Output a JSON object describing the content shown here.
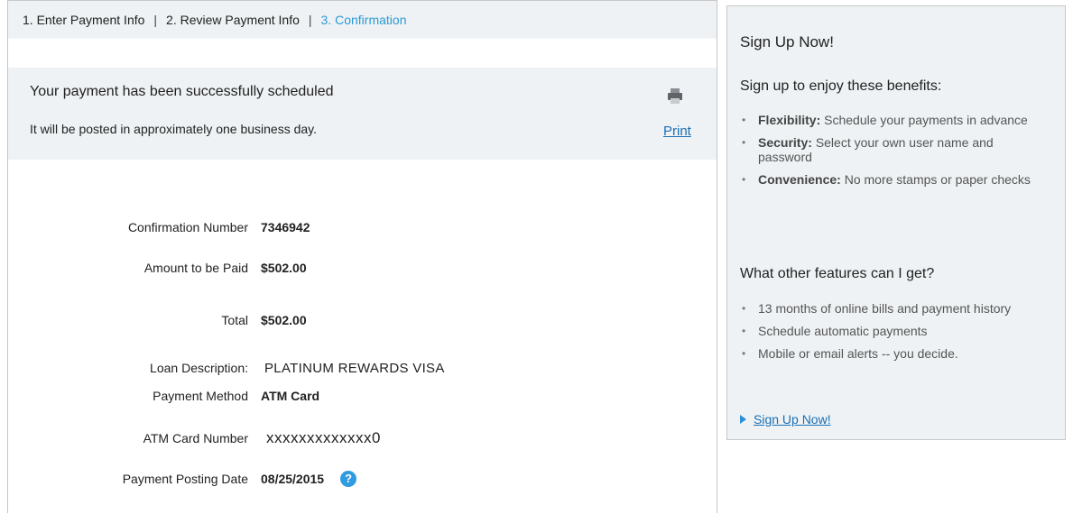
{
  "steps": {
    "step1": "1. Enter Payment Info",
    "step2": "2. Review Payment Info",
    "step3": "3. Confirmation",
    "separator": "|"
  },
  "notice": {
    "headline": "Your payment has been successfully scheduled",
    "sub": "It will be posted in approximately one business day.",
    "print_label": "Print"
  },
  "details": {
    "confirmation_label": "Confirmation Number",
    "confirmation_value": "7346942",
    "amount_label": "Amount to be Paid",
    "amount_value": "$502.00",
    "total_label": "Total",
    "total_value": "$502.00",
    "loan_label": "Loan Description:",
    "loan_value": "PLATINUM REWARDS VISA",
    "method_label": "Payment Method",
    "method_value": "ATM Card",
    "card_label": "ATM Card Number",
    "card_value": "xxxxxxxxxxxxx0",
    "date_label": "Payment Posting Date",
    "date_value": "08/25/2015",
    "help_glyph": "?"
  },
  "sidebar": {
    "title": "Sign Up Now!",
    "benefits_heading": "Sign up to enjoy these benefits:",
    "benefits": [
      {
        "term": "Flexibility:",
        "text": "Schedule your payments in advance"
      },
      {
        "term": "Security:",
        "text": "Select your own user name and password"
      },
      {
        "term": "Convenience:",
        "text": "No more stamps or paper checks"
      }
    ],
    "features_heading": "What other features can I get?",
    "features": [
      "13 months of online bills and payment history",
      "Schedule automatic payments",
      "Mobile or email alerts -- you decide."
    ],
    "signup_link": "Sign Up Now!"
  },
  "colors": {
    "accent": "#2b9ad6",
    "link": "#1a6fb5",
    "panel_bg": "#eef2f4"
  }
}
